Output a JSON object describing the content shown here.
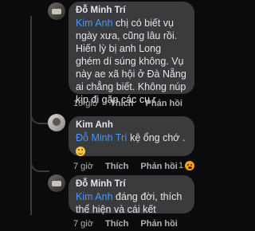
{
  "comments": [
    {
      "author": "Đỗ Minh Trí",
      "mention": "Kim Anh",
      "text_line1": " chị có biết vụ",
      "text_rest": "ngày xưa, cũng lâu rồi. Hiến lỳ bị anh Long ghém dí súng không. Vụ này ae xã hội ở Đà Nẵng ai chẳng biết. Không núp kịp đi gặp các cụ r",
      "time": "10 giờ",
      "like": "Thích",
      "reply": "Phản hồi"
    },
    {
      "author": "Kim Anh",
      "mention": "Đỗ Minh Trí",
      "text": " kệ ổng chớ .",
      "emoji": "grinning-emoji",
      "time": "7 giờ",
      "like": "Thích",
      "reply": "Phản hồi",
      "reaction_count": "1"
    },
    {
      "author": "Đỗ Minh Trí",
      "mention": "Kim Anh",
      "text": " đáng đời, thích thể hiện và cái kết",
      "time": "7 giờ",
      "like": "Thích",
      "reply": "Phản hồi"
    }
  ]
}
